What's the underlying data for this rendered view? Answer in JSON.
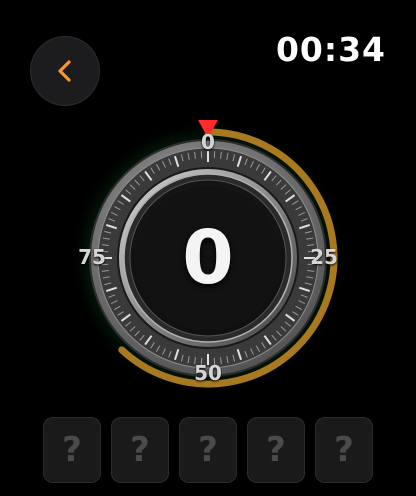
{
  "header": {
    "back_icon": "chevron-left-icon",
    "timer": "00:34"
  },
  "dial": {
    "labels": [
      "0",
      "25",
      "50",
      "75"
    ],
    "current_value": "0",
    "pointer_icon": "triangle-down-icon",
    "progress_fraction": 0.62,
    "colors": {
      "progress": "#a8791f",
      "glow": "#1fcf4a",
      "pointer": "#ff2a2a"
    }
  },
  "code_slots": [
    "?",
    "?",
    "?",
    "?",
    "?"
  ]
}
